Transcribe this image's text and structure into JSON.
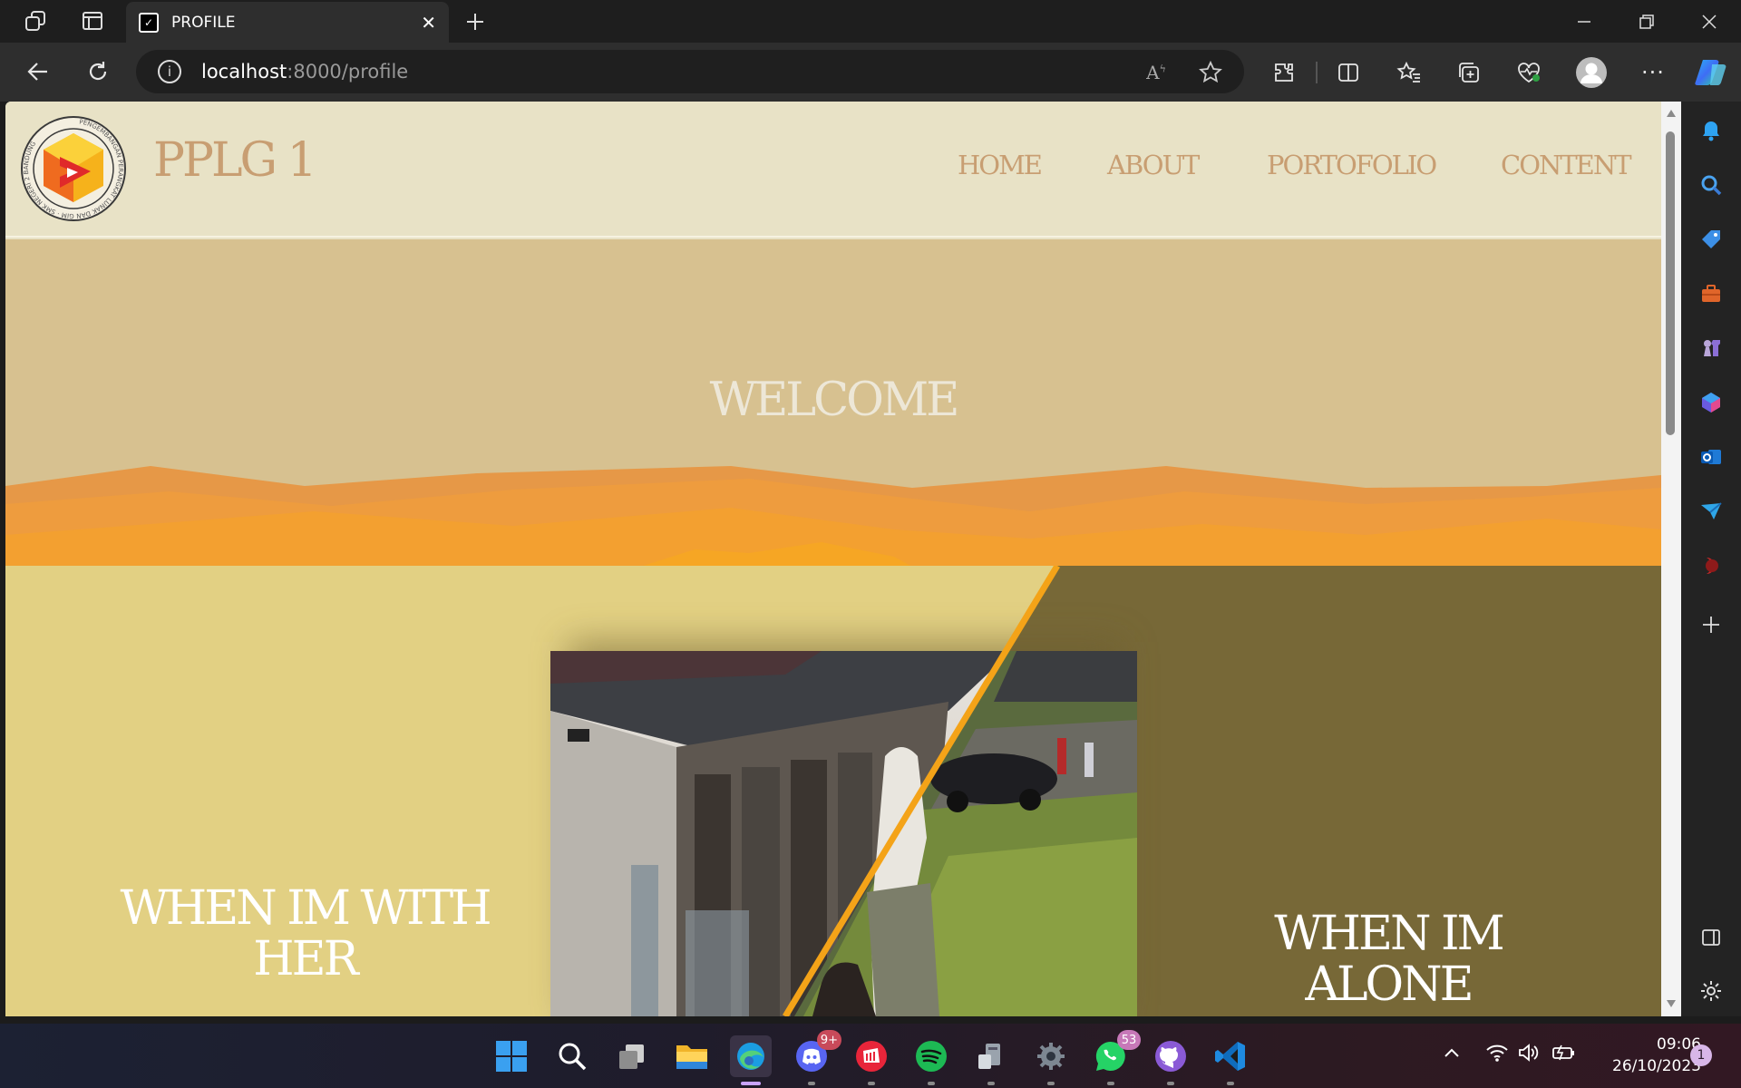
{
  "browser": {
    "tab_title": "PROFILE",
    "url_host": "localhost",
    "url_path": ":8000/profile"
  },
  "site": {
    "brand": "PPLG 1",
    "logo_ring_text": "PENGEMBANGAN PERANGKAT LUNAK DAN GIM · SMK NEGERI 2 BANDUNG",
    "nav": [
      "HOME",
      "ABOUT",
      "PORTOFOLIO",
      "CONTENT"
    ],
    "hero_title": "WELCOME",
    "left_caption_line1": "WHEN IM WITH",
    "left_caption_line2": "HER",
    "right_caption": "WHEN IM ALONE"
  },
  "colors": {
    "header_bg": "#e8e2c6",
    "nav_text": "#c89e72",
    "hero_bg": "#d7c190",
    "left_panel": "#e2d083",
    "right_panel": "#776837",
    "accent_stripe": "#f4a318"
  },
  "taskbar": {
    "discord_badge": "9+",
    "whatsapp_badge": "53",
    "time": "09:06",
    "date": "26/10/2023",
    "notification_count": "1"
  }
}
